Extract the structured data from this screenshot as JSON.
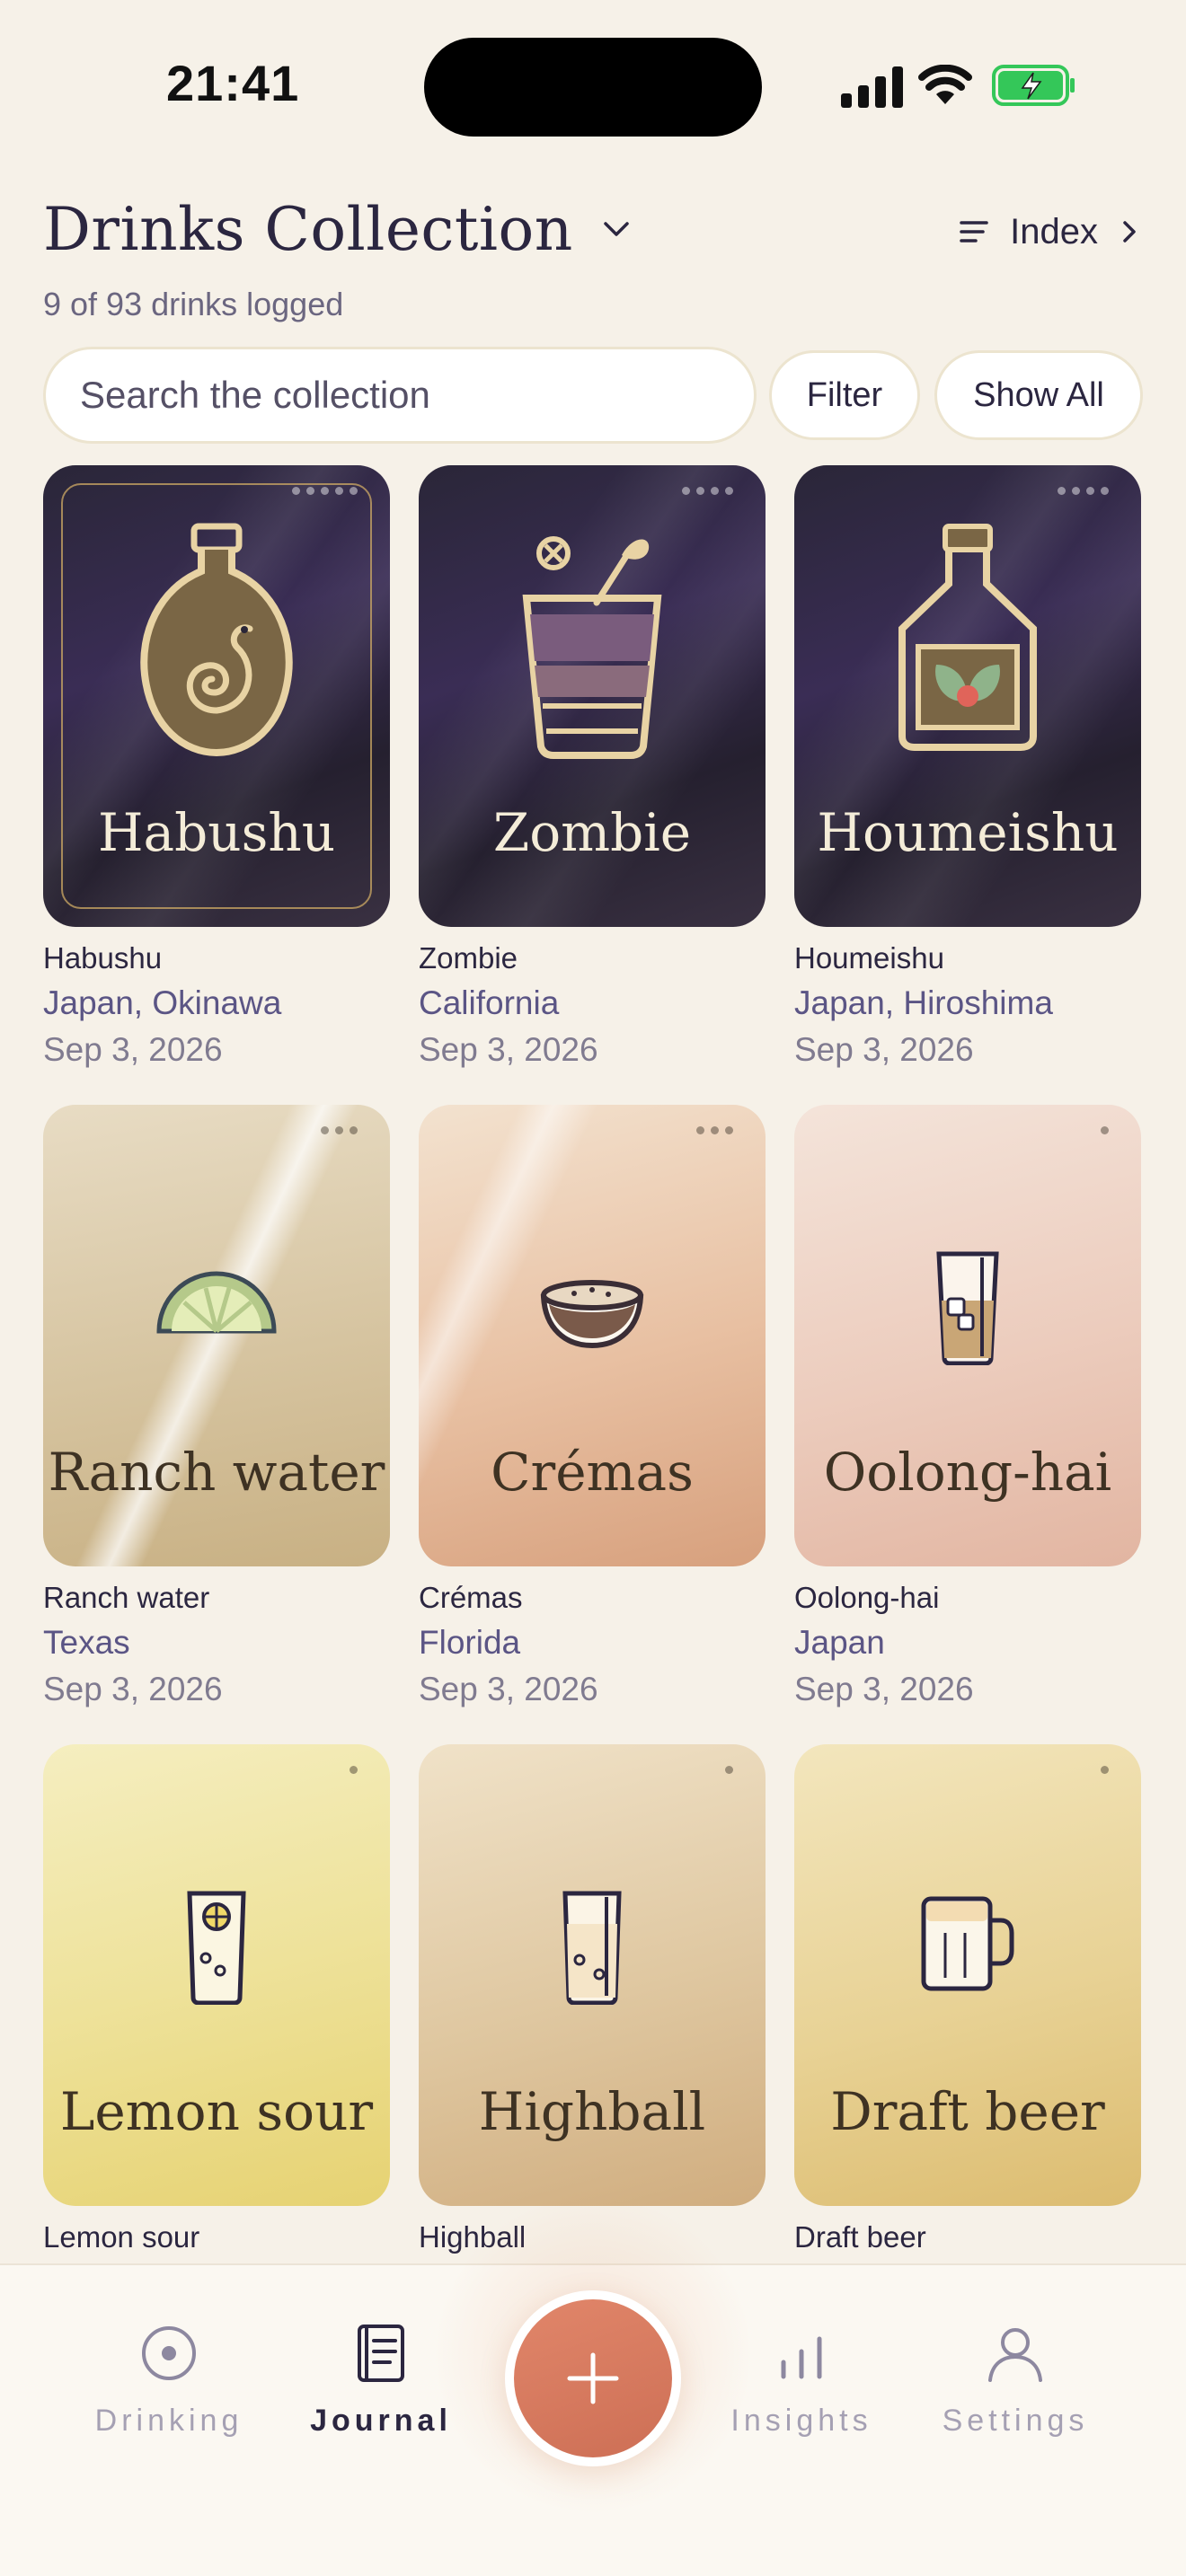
{
  "status": {
    "time": "21:41",
    "signal_icon": "cellular-signal-icon",
    "wifi_icon": "wifi-icon",
    "battery_icon": "battery-charging-icon"
  },
  "header": {
    "title": "Drinks Collection",
    "index_label": "Index",
    "subtitle": "9 of 93 drinks logged"
  },
  "search": {
    "placeholder": "Search the collection",
    "filter_label": "Filter",
    "show_all_label": "Show All"
  },
  "drinks": [
    {
      "name": "Habushu",
      "origin": "Japan, Okinawa",
      "date": "Sep 3, 2026",
      "icon": "snake-bottle-icon"
    },
    {
      "name": "Zombie",
      "origin": "California",
      "date": "Sep 3, 2026",
      "icon": "tiki-glass-icon"
    },
    {
      "name": "Houmeishu",
      "origin": "Japan, Hiroshima",
      "date": "Sep 3, 2026",
      "icon": "herb-bottle-icon"
    },
    {
      "name": "Ranch water",
      "origin": "Texas",
      "date": "Sep 3, 2026",
      "icon": "lime-wedge-icon"
    },
    {
      "name": "Crémas",
      "origin": "Florida",
      "date": "Sep 3, 2026",
      "icon": "coconut-bowl-icon"
    },
    {
      "name": "Oolong-hai",
      "origin": "Japan",
      "date": "Sep 3, 2026",
      "icon": "tall-glass-ice-icon"
    },
    {
      "name": "Lemon sour",
      "icon": "lemon-glass-icon"
    },
    {
      "name": "Highball",
      "icon": "highball-glass-icon"
    },
    {
      "name": "Draft beer",
      "icon": "beer-mug-icon"
    }
  ],
  "tabs": [
    {
      "label": "Drinking",
      "icon": "target-icon",
      "active": false
    },
    {
      "label": "Journal",
      "icon": "journal-icon",
      "active": true
    },
    {
      "label": "Insights",
      "icon": "bar-chart-icon",
      "active": false
    },
    {
      "label": "Settings",
      "icon": "person-icon",
      "active": false
    }
  ],
  "add_button": {
    "icon": "plus-icon"
  },
  "colors": {
    "background": "#f6f1e8",
    "accent": "#d77a5f",
    "text": "#2b2640",
    "origin_text": "#5b5585"
  }
}
